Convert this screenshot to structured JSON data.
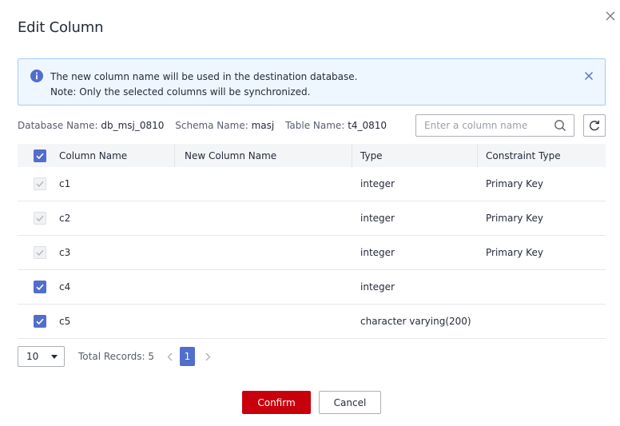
{
  "dialog": {
    "title": "Edit Column",
    "colors": {
      "brand_red": "#c7000b",
      "accent_blue": "#526ecc",
      "info_bg": "#eef6ff"
    }
  },
  "alert": {
    "icon": "info-icon",
    "line1": "The new column name will be used in the destination database.",
    "line2": "Note: Only the selected columns will be synchronized."
  },
  "info": {
    "db_label": "Database Name:",
    "db_value": "db_msj_0810",
    "schema_label": "Schema Name:",
    "schema_value": "masj",
    "table_label": "Table Name:",
    "table_value": "t4_0810"
  },
  "search": {
    "placeholder": "Enter a column name",
    "value": ""
  },
  "table": {
    "headers": {
      "name": "Column Name",
      "new_name": "New Column Name",
      "type": "Type",
      "constraint": "Constraint Type"
    },
    "rows": [
      {
        "name": "c1",
        "new_name": "",
        "type": "integer",
        "constraint": "Primary Key",
        "checked": true,
        "disabled": true
      },
      {
        "name": "c2",
        "new_name": "",
        "type": "integer",
        "constraint": "Primary Key",
        "checked": true,
        "disabled": true
      },
      {
        "name": "c3",
        "new_name": "",
        "type": "integer",
        "constraint": "Primary Key",
        "checked": true,
        "disabled": true
      },
      {
        "name": "c4",
        "new_name": "",
        "type": "integer",
        "constraint": "",
        "checked": true,
        "disabled": false
      },
      {
        "name": "c5",
        "new_name": "",
        "type": "character varying(200)",
        "constraint": "",
        "checked": true,
        "disabled": false
      }
    ]
  },
  "pagination": {
    "page_size": "10",
    "total_label": "Total Records: 5",
    "current_page": "1"
  },
  "buttons": {
    "confirm": "Confirm",
    "cancel": "Cancel"
  }
}
